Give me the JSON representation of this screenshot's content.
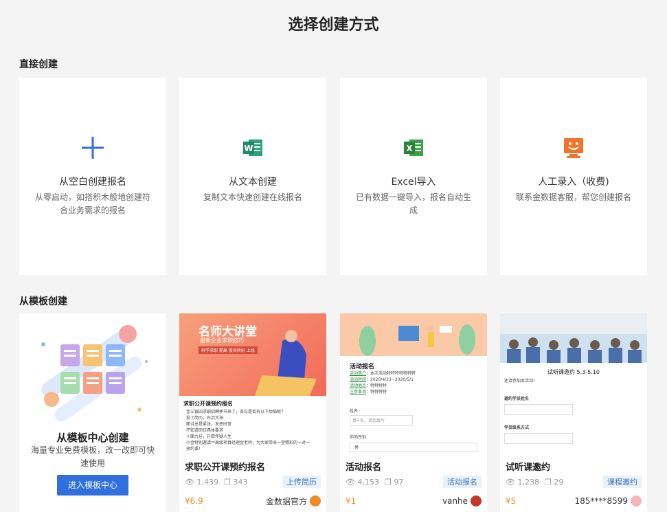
{
  "page_title": "选择创建方式",
  "direct": {
    "heading": "直接创建",
    "cards": [
      {
        "icon": "plus-icon",
        "title": "从空白创建报名",
        "desc": "从零启动，如搭积木般地创建符合业务需求的报名"
      },
      {
        "icon": "word-icon",
        "title": "从文本创建",
        "desc": "复制文本快速创建在线报名"
      },
      {
        "icon": "excel-icon",
        "title": "Excel导入",
        "desc": "已有数据一键导入，报名自动生成"
      },
      {
        "icon": "service-icon",
        "title": "人工录入（收费)",
        "desc": "联系金数据客服，帮您创建报名"
      }
    ]
  },
  "template": {
    "heading": "从模板创建",
    "center": {
      "title": "从模板中心创建",
      "desc": "海量专业免费模板，改一改即可快速使用",
      "button": "进入模板中心"
    },
    "items": [
      {
        "title": "求职公开课预约报名",
        "views": "1,439",
        "copies": "343",
        "tag": "上传简历",
        "price": "¥6.9",
        "author": "金数据官方",
        "thumb": {
          "banner": "名师大讲堂",
          "banner_sub": "最新企业求职技巧",
          "banner_tag": "科学求职 提高    投其所好 上线",
          "heading": "求职公开课预约报名",
          "lines": [
            "金三银四求职招聘季节来了，各位是否有以下烦恼呢？",
            "投了简历，石沉大海",
            "面试总是紧张，发挥时常",
            "不知道岗位具体要求",
            "十面九挂，升职怀疑人生",
            "小金特别邀请**高级项目经理金老师，为大家带来一堂精彩的一对一",
            "预约课！"
          ]
        }
      },
      {
        "title": "活动报名",
        "views": "4,153",
        "copies": "97",
        "tag": "活动报名",
        "price": "¥1",
        "author": "vanhe",
        "thumb": {
          "heading": "活动报名",
          "labels": [
            "活动简介",
            "活动时间",
            "活动地点",
            "注意事项"
          ],
          "values": [
            "本次活动特特特特特特特",
            "2020/4/23~2020/5/1",
            "特特特特",
            "特特特特"
          ],
          "field1": "姓名",
          "placeholder1": "目+名，请您填写",
          "field2": "你的性别",
          "option": "男"
        }
      },
      {
        "title": "试听课邀约",
        "views": "1,238",
        "copies": "29",
        "tag": "课程邀约",
        "price": "¥5",
        "author": "185****8599",
        "thumb": {
          "heading": "试听课邀约 5.3-5.10",
          "sub": "还请参加本活动!",
          "field1": "邀约学员姓名",
          "field2": "学员联系方式"
        }
      }
    ]
  },
  "colors": {
    "accent": "#2f6fe0",
    "price": "#f08a24"
  }
}
